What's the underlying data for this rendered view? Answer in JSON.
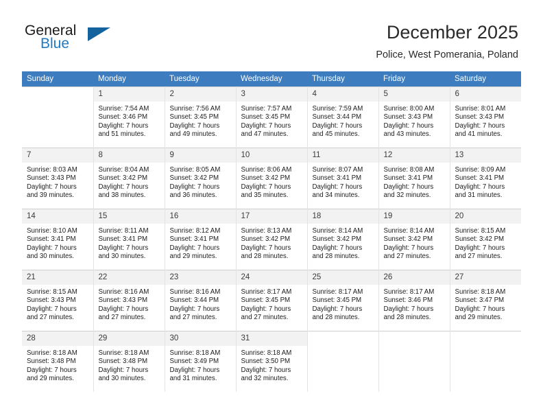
{
  "brand": {
    "name_top": "General",
    "name_bottom": "Blue",
    "triangle_color": "#14639f",
    "blue_color": "#1f7ac4"
  },
  "header": {
    "title": "December 2025",
    "subtitle": "Police, West Pomerania, Poland"
  },
  "calendar": {
    "header_bg": "#3d7dbf",
    "daynum_bg": "#f2f2f2",
    "weekday_headers": [
      "Sunday",
      "Monday",
      "Tuesday",
      "Wednesday",
      "Thursday",
      "Friday",
      "Saturday"
    ],
    "weeks": [
      [
        {
          "day": "",
          "empty": true,
          "sunrise": "",
          "sunset": "",
          "daylight_1": "",
          "daylight_2": ""
        },
        {
          "day": "1",
          "sunrise": "Sunrise: 7:54 AM",
          "sunset": "Sunset: 3:46 PM",
          "daylight_1": "Daylight: 7 hours",
          "daylight_2": "and 51 minutes."
        },
        {
          "day": "2",
          "sunrise": "Sunrise: 7:56 AM",
          "sunset": "Sunset: 3:45 PM",
          "daylight_1": "Daylight: 7 hours",
          "daylight_2": "and 49 minutes."
        },
        {
          "day": "3",
          "sunrise": "Sunrise: 7:57 AM",
          "sunset": "Sunset: 3:45 PM",
          "daylight_1": "Daylight: 7 hours",
          "daylight_2": "and 47 minutes."
        },
        {
          "day": "4",
          "sunrise": "Sunrise: 7:59 AM",
          "sunset": "Sunset: 3:44 PM",
          "daylight_1": "Daylight: 7 hours",
          "daylight_2": "and 45 minutes."
        },
        {
          "day": "5",
          "sunrise": "Sunrise: 8:00 AM",
          "sunset": "Sunset: 3:43 PM",
          "daylight_1": "Daylight: 7 hours",
          "daylight_2": "and 43 minutes."
        },
        {
          "day": "6",
          "sunrise": "Sunrise: 8:01 AM",
          "sunset": "Sunset: 3:43 PM",
          "daylight_1": "Daylight: 7 hours",
          "daylight_2": "and 41 minutes."
        }
      ],
      [
        {
          "day": "7",
          "sunrise": "Sunrise: 8:03 AM",
          "sunset": "Sunset: 3:43 PM",
          "daylight_1": "Daylight: 7 hours",
          "daylight_2": "and 39 minutes."
        },
        {
          "day": "8",
          "sunrise": "Sunrise: 8:04 AM",
          "sunset": "Sunset: 3:42 PM",
          "daylight_1": "Daylight: 7 hours",
          "daylight_2": "and 38 minutes."
        },
        {
          "day": "9",
          "sunrise": "Sunrise: 8:05 AM",
          "sunset": "Sunset: 3:42 PM",
          "daylight_1": "Daylight: 7 hours",
          "daylight_2": "and 36 minutes."
        },
        {
          "day": "10",
          "sunrise": "Sunrise: 8:06 AM",
          "sunset": "Sunset: 3:42 PM",
          "daylight_1": "Daylight: 7 hours",
          "daylight_2": "and 35 minutes."
        },
        {
          "day": "11",
          "sunrise": "Sunrise: 8:07 AM",
          "sunset": "Sunset: 3:41 PM",
          "daylight_1": "Daylight: 7 hours",
          "daylight_2": "and 34 minutes."
        },
        {
          "day": "12",
          "sunrise": "Sunrise: 8:08 AM",
          "sunset": "Sunset: 3:41 PM",
          "daylight_1": "Daylight: 7 hours",
          "daylight_2": "and 32 minutes."
        },
        {
          "day": "13",
          "sunrise": "Sunrise: 8:09 AM",
          "sunset": "Sunset: 3:41 PM",
          "daylight_1": "Daylight: 7 hours",
          "daylight_2": "and 31 minutes."
        }
      ],
      [
        {
          "day": "14",
          "sunrise": "Sunrise: 8:10 AM",
          "sunset": "Sunset: 3:41 PM",
          "daylight_1": "Daylight: 7 hours",
          "daylight_2": "and 30 minutes."
        },
        {
          "day": "15",
          "sunrise": "Sunrise: 8:11 AM",
          "sunset": "Sunset: 3:41 PM",
          "daylight_1": "Daylight: 7 hours",
          "daylight_2": "and 30 minutes."
        },
        {
          "day": "16",
          "sunrise": "Sunrise: 8:12 AM",
          "sunset": "Sunset: 3:41 PM",
          "daylight_1": "Daylight: 7 hours",
          "daylight_2": "and 29 minutes."
        },
        {
          "day": "17",
          "sunrise": "Sunrise: 8:13 AM",
          "sunset": "Sunset: 3:42 PM",
          "daylight_1": "Daylight: 7 hours",
          "daylight_2": "and 28 minutes."
        },
        {
          "day": "18",
          "sunrise": "Sunrise: 8:14 AM",
          "sunset": "Sunset: 3:42 PM",
          "daylight_1": "Daylight: 7 hours",
          "daylight_2": "and 28 minutes."
        },
        {
          "day": "19",
          "sunrise": "Sunrise: 8:14 AM",
          "sunset": "Sunset: 3:42 PM",
          "daylight_1": "Daylight: 7 hours",
          "daylight_2": "and 27 minutes."
        },
        {
          "day": "20",
          "sunrise": "Sunrise: 8:15 AM",
          "sunset": "Sunset: 3:42 PM",
          "daylight_1": "Daylight: 7 hours",
          "daylight_2": "and 27 minutes."
        }
      ],
      [
        {
          "day": "21",
          "sunrise": "Sunrise: 8:15 AM",
          "sunset": "Sunset: 3:43 PM",
          "daylight_1": "Daylight: 7 hours",
          "daylight_2": "and 27 minutes."
        },
        {
          "day": "22",
          "sunrise": "Sunrise: 8:16 AM",
          "sunset": "Sunset: 3:43 PM",
          "daylight_1": "Daylight: 7 hours",
          "daylight_2": "and 27 minutes."
        },
        {
          "day": "23",
          "sunrise": "Sunrise: 8:16 AM",
          "sunset": "Sunset: 3:44 PM",
          "daylight_1": "Daylight: 7 hours",
          "daylight_2": "and 27 minutes."
        },
        {
          "day": "24",
          "sunrise": "Sunrise: 8:17 AM",
          "sunset": "Sunset: 3:45 PM",
          "daylight_1": "Daylight: 7 hours",
          "daylight_2": "and 27 minutes."
        },
        {
          "day": "25",
          "sunrise": "Sunrise: 8:17 AM",
          "sunset": "Sunset: 3:45 PM",
          "daylight_1": "Daylight: 7 hours",
          "daylight_2": "and 28 minutes."
        },
        {
          "day": "26",
          "sunrise": "Sunrise: 8:17 AM",
          "sunset": "Sunset: 3:46 PM",
          "daylight_1": "Daylight: 7 hours",
          "daylight_2": "and 28 minutes."
        },
        {
          "day": "27",
          "sunrise": "Sunrise: 8:18 AM",
          "sunset": "Sunset: 3:47 PM",
          "daylight_1": "Daylight: 7 hours",
          "daylight_2": "and 29 minutes."
        }
      ],
      [
        {
          "day": "28",
          "sunrise": "Sunrise: 8:18 AM",
          "sunset": "Sunset: 3:48 PM",
          "daylight_1": "Daylight: 7 hours",
          "daylight_2": "and 29 minutes."
        },
        {
          "day": "29",
          "sunrise": "Sunrise: 8:18 AM",
          "sunset": "Sunset: 3:48 PM",
          "daylight_1": "Daylight: 7 hours",
          "daylight_2": "and 30 minutes."
        },
        {
          "day": "30",
          "sunrise": "Sunrise: 8:18 AM",
          "sunset": "Sunset: 3:49 PM",
          "daylight_1": "Daylight: 7 hours",
          "daylight_2": "and 31 minutes."
        },
        {
          "day": "31",
          "sunrise": "Sunrise: 8:18 AM",
          "sunset": "Sunset: 3:50 PM",
          "daylight_1": "Daylight: 7 hours",
          "daylight_2": "and 32 minutes."
        },
        {
          "day": "",
          "empty": true,
          "sunrise": "",
          "sunset": "",
          "daylight_1": "",
          "daylight_2": ""
        },
        {
          "day": "",
          "empty": true,
          "sunrise": "",
          "sunset": "",
          "daylight_1": "",
          "daylight_2": ""
        },
        {
          "day": "",
          "empty": true,
          "sunrise": "",
          "sunset": "",
          "daylight_1": "",
          "daylight_2": ""
        }
      ]
    ]
  }
}
